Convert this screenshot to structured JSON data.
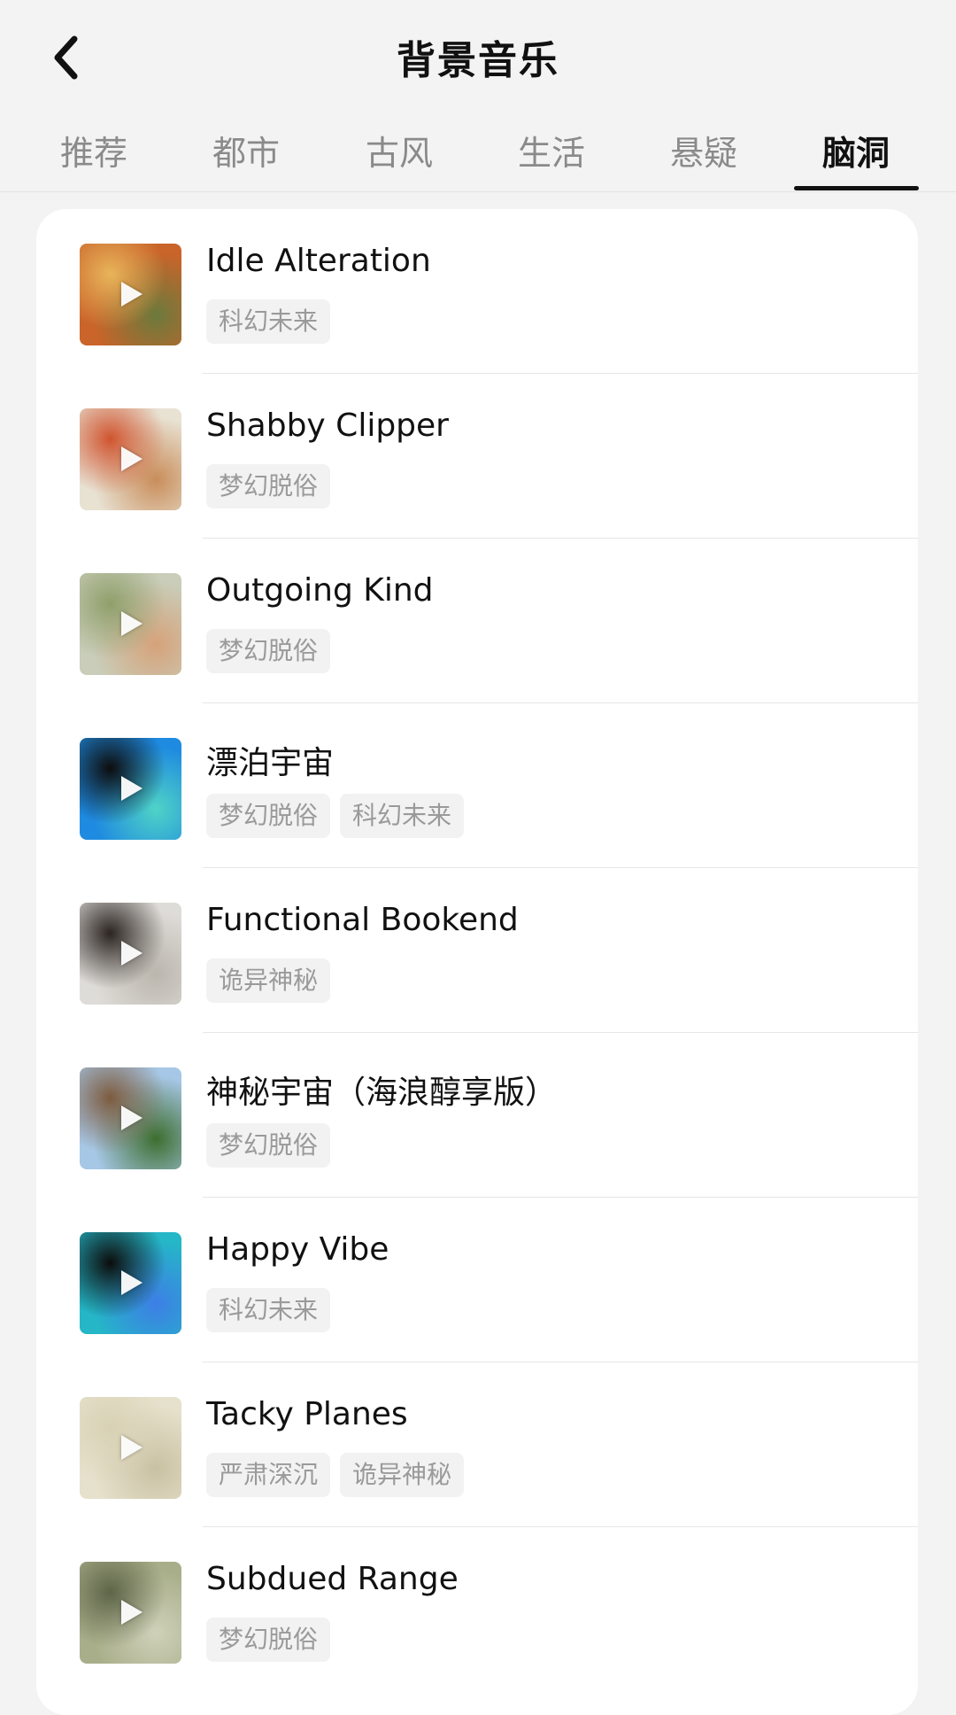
{
  "header": {
    "title": "背景音乐",
    "back_icon": "chevron-left-icon"
  },
  "tabs": [
    {
      "label": "推荐",
      "active": false
    },
    {
      "label": "都市",
      "active": false
    },
    {
      "label": "古风",
      "active": false
    },
    {
      "label": "生活",
      "active": false
    },
    {
      "label": "悬疑",
      "active": false
    },
    {
      "label": "脑洞",
      "active": true
    }
  ],
  "tracks": [
    {
      "title": "Idle Alteration",
      "tags": [
        "科幻未来"
      ],
      "thumb_colors": [
        "#c9642a",
        "#e8b45a",
        "#6b7a3c"
      ]
    },
    {
      "title": "Shabby Clipper",
      "tags": [
        "梦幻脱俗"
      ],
      "thumb_colors": [
        "#e8e2d3",
        "#d0542f",
        "#c98d5a"
      ]
    },
    {
      "title": "Outgoing Kind",
      "tags": [
        "梦幻脱俗"
      ],
      "thumb_colors": [
        "#c9cdb9",
        "#8f9f6a",
        "#d6a27a"
      ]
    },
    {
      "title": "漂泊宇宙",
      "tags": [
        "梦幻脱俗",
        "科幻未来"
      ],
      "thumb_colors": [
        "#1f8be0",
        "#0d0d0d",
        "#4fd3c6"
      ]
    },
    {
      "title": "Functional Bookend",
      "tags": [
        "诡异神秘"
      ],
      "thumb_colors": [
        "#dedcd8",
        "#2b2421",
        "#bbb6ad"
      ]
    },
    {
      "title": "神秘宇宙（海浪醇享版）",
      "tags": [
        "梦幻脱俗"
      ],
      "thumb_colors": [
        "#a7c7e6",
        "#7d5b3e",
        "#3e6e2f"
      ]
    },
    {
      "title": "Happy Vibe",
      "tags": [
        "科幻未来"
      ],
      "thumb_colors": [
        "#25b6c7",
        "#0c0c0c",
        "#3d7ee6"
      ]
    },
    {
      "title": "Tacky Planes",
      "tags": [
        "严肃深沉",
        "诡异神秘"
      ],
      "thumb_colors": [
        "#e6e1cc",
        "#d8d1b4",
        "#c9c1a3"
      ]
    },
    {
      "title": "Subdued Range",
      "tags": [
        "梦幻脱俗"
      ],
      "thumb_colors": [
        "#a9ae8a",
        "#5e6548",
        "#cfd1b9"
      ]
    }
  ]
}
